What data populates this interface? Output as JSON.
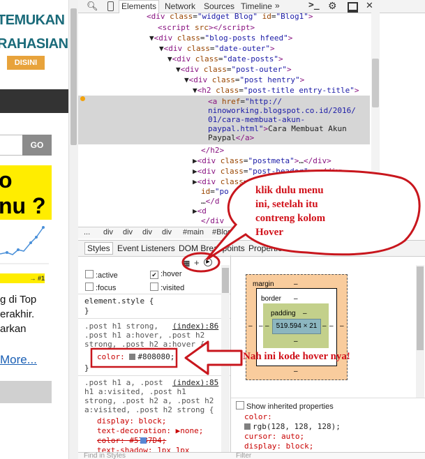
{
  "webpage": {
    "logo_line1": "TEMUKAN",
    "logo_line2": "RAHASIANYA",
    "logo_badge": "DISINI",
    "go_button": "GO",
    "banner_line1": "o",
    "banner_line2": "nu ?",
    "badge": "→ #1",
    "text_line1": "g di Top",
    "text_line2": "erakhir.",
    "text_line3": "arkan",
    "more_link": "More..."
  },
  "devtools": {
    "tabs": [
      "Elements",
      "Network",
      "Sources",
      "Timeline"
    ],
    "breadcrumb": [
      "...",
      "div",
      "div",
      "div",
      "div",
      "#main",
      "#Blog"
    ],
    "panel_tabs": [
      "Styles",
      "Event Listeners",
      "DOM Breakpoints",
      "Properties"
    ],
    "state_options": [
      ":active",
      ":hover",
      ":focus",
      ":visited"
    ],
    "hover_checked": true,
    "element_style": "element.style {",
    "element_style_close": "}",
    "rule1_selector": [
      ".post h1 strong,",
      ".post h1 a:hover, .post h2",
      "strong, .post h2 a:hover {"
    ],
    "rule1_source": "(index):86",
    "rule1_prop": "color:",
    "rule1_value": "#808080;",
    "rule1_close": "}",
    "rule2_selector": [
      ".post h1 a, .post",
      "h1 a:visited, .post h1",
      "strong, .post h2 a, .post h2",
      "a:visited, .post h2 strong {"
    ],
    "rule2_source": "(index):85",
    "rule2_props": [
      "display: block;",
      "text-decoration: ▶none;",
      "color: #5787D4;",
      "text-shadow: 1px 1px"
    ],
    "find_in_styles": "Find in Styles",
    "box_model": {
      "margin_label": "margin",
      "border_label": "border",
      "padding_label": "padding",
      "content": "519.594 × 21",
      "dash": "–"
    },
    "computed": {
      "show_inherited": "Show inherited properties",
      "items": [
        "color:",
        "rgb(128, 128, 128);",
        "cursor: auto;",
        "display: block;"
      ]
    },
    "filter": "Filter",
    "colors": {
      "gray": "#808080",
      "blue": "#5787D4"
    }
  },
  "annotations": {
    "callout": [
      "klik dulu menu",
      "ini, setelah itu",
      "contreng kolom",
      "Hover"
    ],
    "arrow_note": "Nah ini kode hover nya!"
  }
}
